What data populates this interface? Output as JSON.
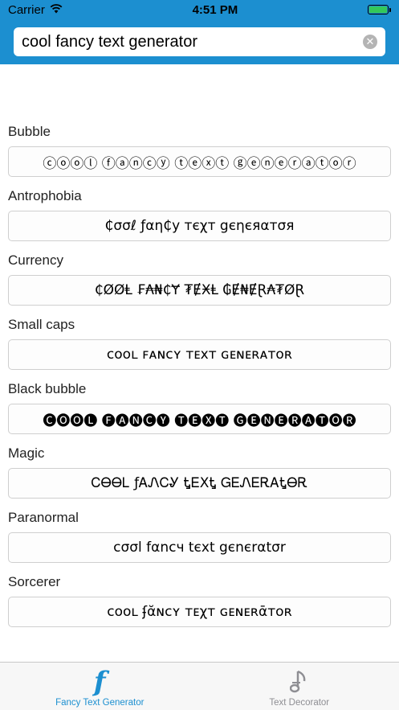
{
  "status_bar": {
    "carrier": "Carrier",
    "time": "4:51 PM"
  },
  "search": {
    "value": "cool fancy text generator",
    "clear_symbol": "✕"
  },
  "styles": [
    {
      "name": "Bubble",
      "text": "ⓒⓞⓞⓛ ⓕⓐⓝⓒⓨ ⓣⓔⓧⓣ ⓖⓔⓝⓔⓡⓐⓣⓞⓡ"
    },
    {
      "name": "Antrophobia",
      "text": "₵σσℓ ƒαη₵у тєχт gєηєяαтσя"
    },
    {
      "name": "Currency",
      "text": "₵ØØⱠ ₣₳₦₵Ɏ ₮ɆӾⱠ ₲Ɇ₦ɆⱤ₳₮ØⱤ"
    },
    {
      "name": "Small caps",
      "text": "ᴄᴏᴏʟ ꜰᴀɴᴄʏ ᴛᴇxᴛ ɢᴇɴᴇʀᴀᴛᴏʀ"
    },
    {
      "name": "Black bubble",
      "text": "🅒🅞🅞🅛 🅕🅐🅝🅒🅨 🅣🅔🅧🅣 🅖🅔🅝🅔🅡🅐🅣🅞🅡"
    },
    {
      "name": "Magic",
      "text": "ᏟᎾᎾᏞ ƒᎪᏁᏟᎽ ᎿᎬХᎿ ᏀᎬᏁᎬᎡᎪᎿᎾᎡ"
    },
    {
      "name": "Paranormal",
      "text": "cσσl fαncч tєxt gєnєrαtσr"
    },
    {
      "name": "Sorcerer",
      "text": "ᴄᴏᴏʟ ʄᾰɴᴄʏ ᴛᴇχᴛ ɢᴇɴᴇʀᾱᴛᴏʀ"
    }
  ],
  "tabs": [
    {
      "label": "Fancy Text Generator",
      "icon": "fx-icon",
      "active": true
    },
    {
      "label": "Text Decorator",
      "icon": "music-note-icon",
      "active": false
    }
  ],
  "colors": {
    "accent": "#1c8fd0",
    "battery": "#34c759",
    "inactive": "#8e8e93"
  }
}
